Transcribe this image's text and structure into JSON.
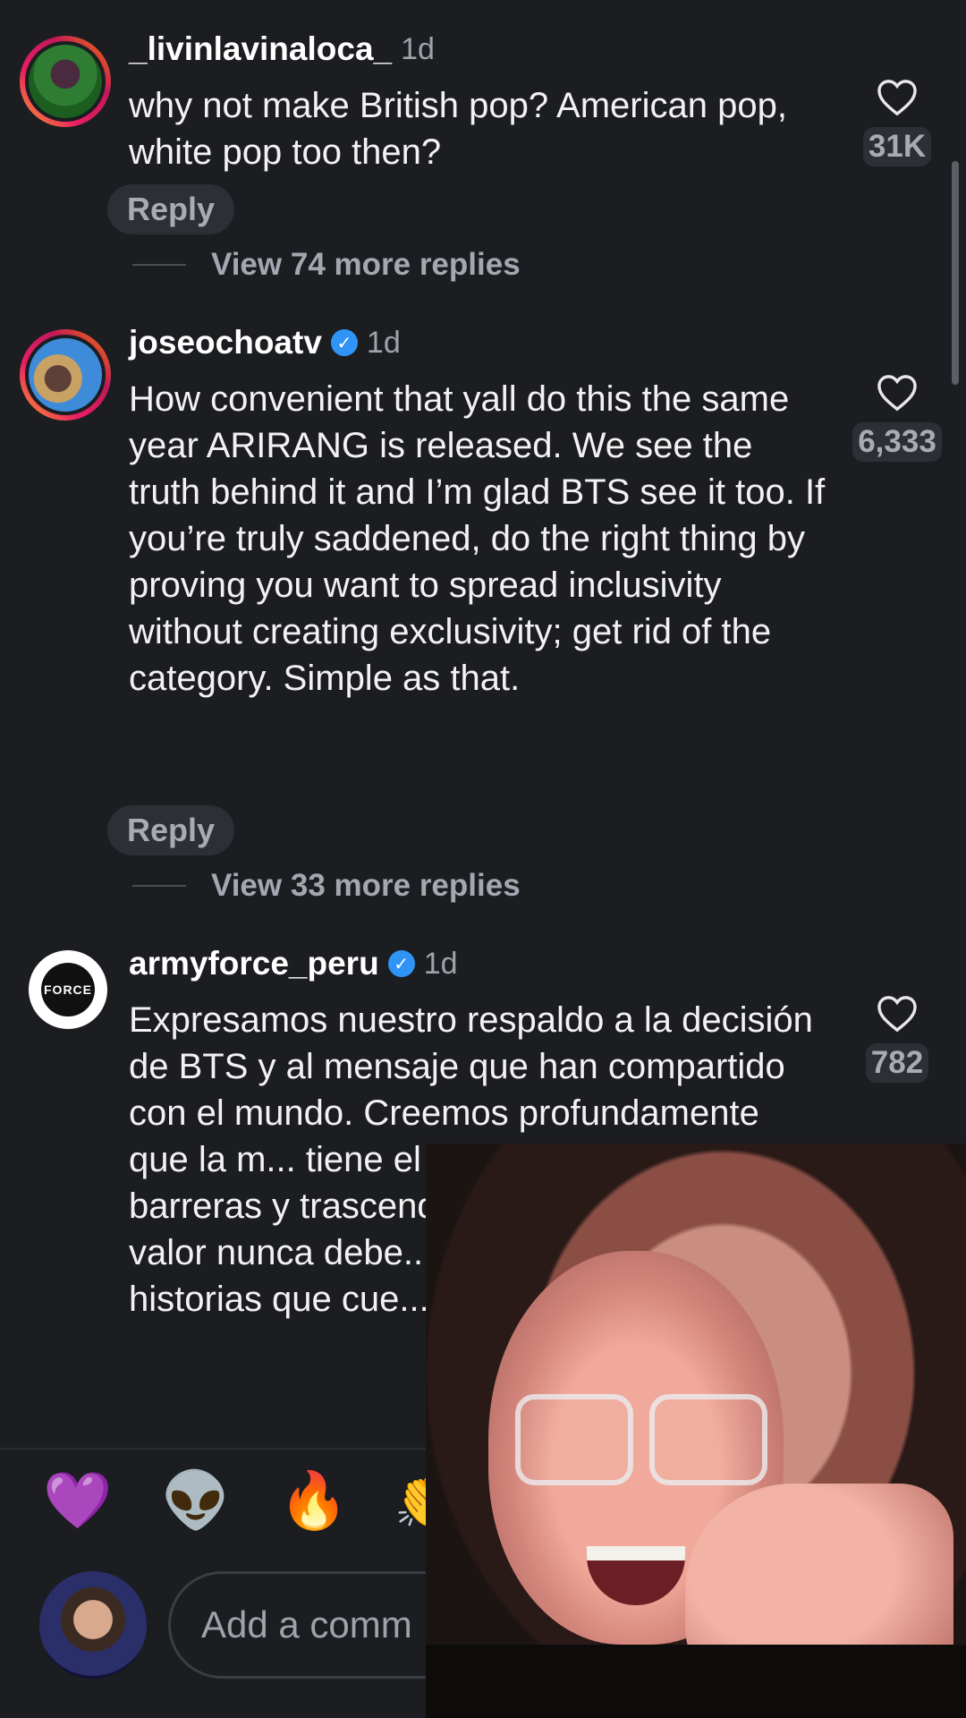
{
  "comments": [
    {
      "username": "_livinlavinaloca_",
      "time": "1d",
      "verified": false,
      "text": "why not make British pop? American pop, white pop too then?",
      "likes": "31K",
      "reply_label": "Reply",
      "view_more": "View 74 more replies"
    },
    {
      "username": "joseochoatv",
      "time": "1d",
      "verified": true,
      "text": "How convenient that yall do this the same year ARIRANG is released. We see the truth behind it and I’m glad BTS see it too. If you’re truly saddened, do the right thing by proving you want to spread inclusivity without creating exclusivity; get rid of the category. Simple as that.",
      "likes": "6,333",
      "reply_label": "Reply",
      "view_more": "View 33 more replies"
    },
    {
      "username": "armyforce_peru",
      "time": "1d",
      "verified": true,
      "text": "Expresamos nuestro respaldo a la decisión de BTS y al mensaje que han compartido con el mundo. Creemos profundamente que la m... tiene el poder de unir person... barreras y trascend... idioma, nacionali... valor nunca debe... lugar del que pro... historias que cue...",
      "likes": "782",
      "avatar_text": "FORCE"
    }
  ],
  "emoji_bar": [
    {
      "icon": "purple-heart-emoji",
      "glyph": "💜"
    },
    {
      "icon": "alien-emoji",
      "glyph": "👽"
    },
    {
      "icon": "fire-emoji",
      "glyph": "🔥"
    },
    {
      "icon": "clapping-hands-emoji",
      "glyph": "👏"
    }
  ],
  "composer": {
    "placeholder": "Add a comm"
  },
  "colors": {
    "background": "#1b1d21",
    "verified": "#2f94f6",
    "secondary_text": "#9ea3ab"
  }
}
